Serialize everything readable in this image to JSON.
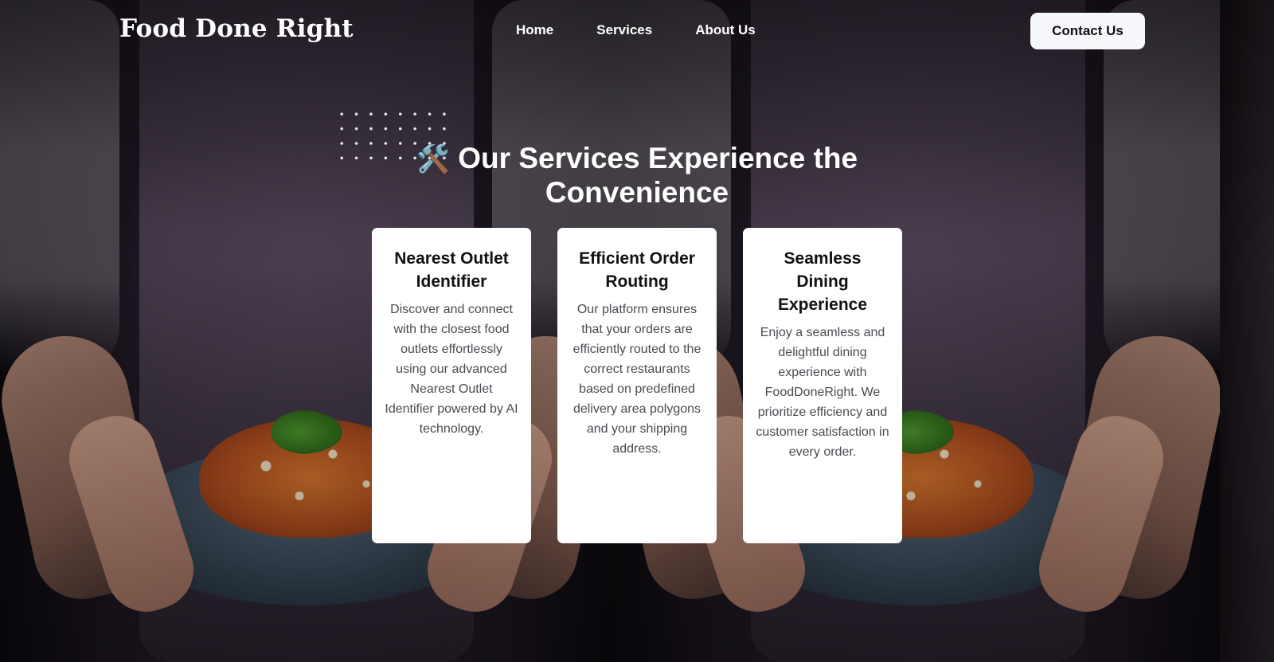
{
  "header": {
    "logo": "Food Done Right",
    "nav": [
      "Home",
      "Services",
      "About Us"
    ],
    "contact_label": "Contact Us"
  },
  "section": {
    "icon": "🛠️",
    "icon_name": "hammer-wrench-icon",
    "title": "Our Services Experience the Convenience"
  },
  "cards": [
    {
      "title": "Nearest Outlet Identifier",
      "body": "Discover and connect with the closest food outlets effortlessly using our advanced Nearest Outlet Identifier powered by AI technology."
    },
    {
      "title": "Efficient Order Routing",
      "body": "Our platform ensures that your orders are efficiently routed to the correct restaurants based on predefined delivery area polygons and your shipping address."
    },
    {
      "title": "Seamless Dining Experience",
      "body": "Enjoy a seamless and delightful dining experience with FoodDoneRight. We prioritize efficiency and customer satisfaction in every order."
    }
  ],
  "colors": {
    "card_bg": "#ffffff",
    "button_bg": "#f7f8fb",
    "text_light": "#ffffff",
    "text_dark": "#111111",
    "body_text": "#4a4a52"
  }
}
